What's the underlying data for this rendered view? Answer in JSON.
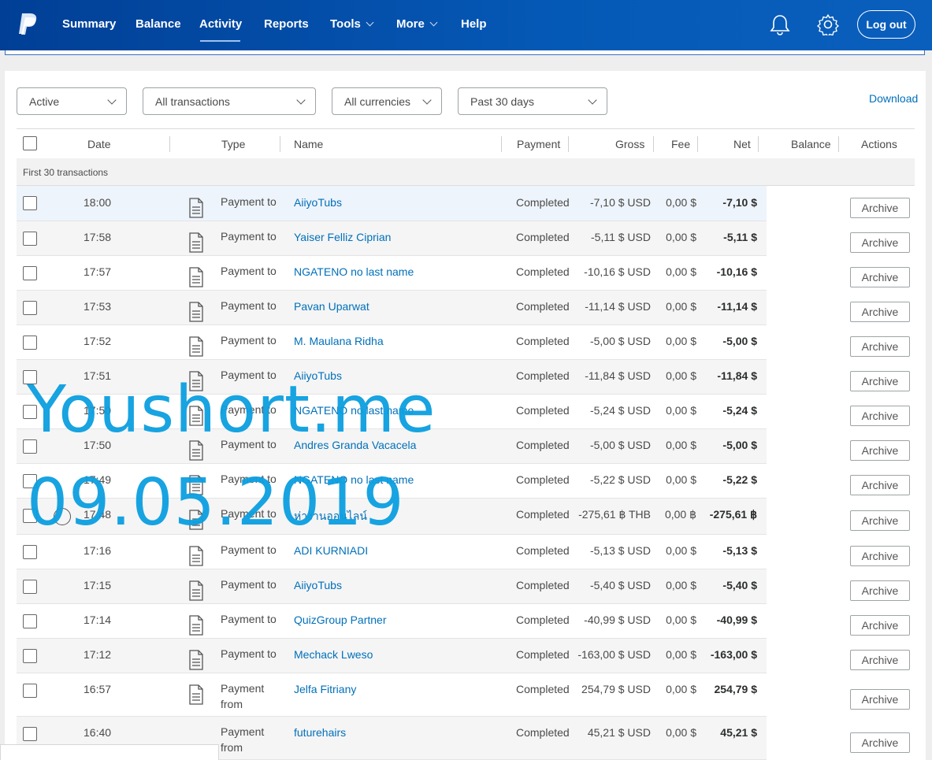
{
  "nav": {
    "items": [
      {
        "label": "Summary"
      },
      {
        "label": "Balance"
      },
      {
        "label": "Activity"
      },
      {
        "label": "Reports"
      },
      {
        "label": "Tools"
      },
      {
        "label": "More"
      },
      {
        "label": "Help"
      }
    ],
    "logout_label": "Log out"
  },
  "filters": {
    "status": "Active",
    "type": "All transactions",
    "currency": "All currencies",
    "period": "Past 30 days",
    "download_label": "Download"
  },
  "table": {
    "headers": {
      "date": "Date",
      "type": "Type",
      "name": "Name",
      "payment": "Payment",
      "gross": "Gross",
      "fee": "Fee",
      "net": "Net",
      "balance": "Balance",
      "actions": "Actions"
    },
    "subheader": "First 30 transactions",
    "archive_label": "Archive",
    "rows": [
      {
        "time": "18:00",
        "type": "Payment to",
        "name": "AiiyoTubs",
        "status": "Completed",
        "gross": "-7,10 $ USD",
        "fee": "0,00 $",
        "net": "-7,10 $"
      },
      {
        "time": "17:58",
        "type": "Payment to",
        "name": "Yaiser Felliz Ciprian",
        "status": "Completed",
        "gross": "-5,11 $ USD",
        "fee": "0,00 $",
        "net": "-5,11 $"
      },
      {
        "time": "17:57",
        "type": "Payment to",
        "name": "NGATENO no last name",
        "status": "Completed",
        "gross": "-10,16 $ USD",
        "fee": "0,00 $",
        "net": "-10,16 $"
      },
      {
        "time": "17:53",
        "type": "Payment to",
        "name": "Pavan Uparwat",
        "status": "Completed",
        "gross": "-11,14 $ USD",
        "fee": "0,00 $",
        "net": "-11,14 $"
      },
      {
        "time": "17:52",
        "type": "Payment to",
        "name": "M. Maulana Ridha",
        "status": "Completed",
        "gross": "-5,00 $ USD",
        "fee": "0,00 $",
        "net": "-5,00 $"
      },
      {
        "time": "17:51",
        "type": "Payment to",
        "name": "AiiyoTubs",
        "status": "Completed",
        "gross": "-11,84 $ USD",
        "fee": "0,00 $",
        "net": "-11,84 $"
      },
      {
        "time": "17:50",
        "type": "Payment to",
        "name": "NGATENO no last name",
        "status": "Completed",
        "gross": "-5,24 $ USD",
        "fee": "0,00 $",
        "net": "-5,24 $"
      },
      {
        "time": "17:50",
        "type": "Payment to",
        "name": "Andres Granda Vacacela",
        "status": "Completed",
        "gross": "-5,00 $ USD",
        "fee": "0,00 $",
        "net": "-5,00 $"
      },
      {
        "time": "17:49",
        "type": "Payment to",
        "name": "NGATENO no last name",
        "status": "Completed",
        "gross": "-5,22 $ USD",
        "fee": "0,00 $",
        "net": "-5,22 $"
      },
      {
        "time": "17:48",
        "type": "Payment to",
        "name": "ห่างานออนไลน์",
        "status": "Completed",
        "gross": "-275,61 ฿ THB",
        "fee": "0,00 ฿",
        "net": "-275,61 ฿"
      },
      {
        "time": "17:16",
        "type": "Payment to",
        "name": "ADI KURNIADI",
        "status": "Completed",
        "gross": "-5,13 $ USD",
        "fee": "0,00 $",
        "net": "-5,13 $"
      },
      {
        "time": "17:15",
        "type": "Payment to",
        "name": "AiiyoTubs",
        "status": "Completed",
        "gross": "-5,40 $ USD",
        "fee": "0,00 $",
        "net": "-5,40 $"
      },
      {
        "time": "17:14",
        "type": "Payment to",
        "name": "QuizGroup Partner",
        "status": "Completed",
        "gross": "-40,99 $ USD",
        "fee": "0,00 $",
        "net": "-40,99 $"
      },
      {
        "time": "17:12",
        "type": "Payment to",
        "name": "Mechack Lweso",
        "status": "Completed",
        "gross": "-163,00 $ USD",
        "fee": "0,00 $",
        "net": "-163,00 $"
      },
      {
        "time": "16:57",
        "type_line1": "Payment",
        "type_line2": "from",
        "name": "Jelfa Fitriany",
        "status": "Completed",
        "gross": "254,79 $ USD",
        "fee": "0,00 $",
        "net": "254,79 $"
      },
      {
        "time": "16:40",
        "type_line1": "Payment",
        "type_line2": "from",
        "name": "futurehairs",
        "status": "Completed",
        "gross": "45,21 $ USD",
        "fee": "0,00 $",
        "net": "45,21 $"
      }
    ]
  },
  "watermark": {
    "line1": "Youshort.me",
    "line2": "09.05.2019"
  },
  "colors": {
    "nav_bg": "#0559b6",
    "link": "#0070ba",
    "watermark": "#0c9fe0"
  }
}
